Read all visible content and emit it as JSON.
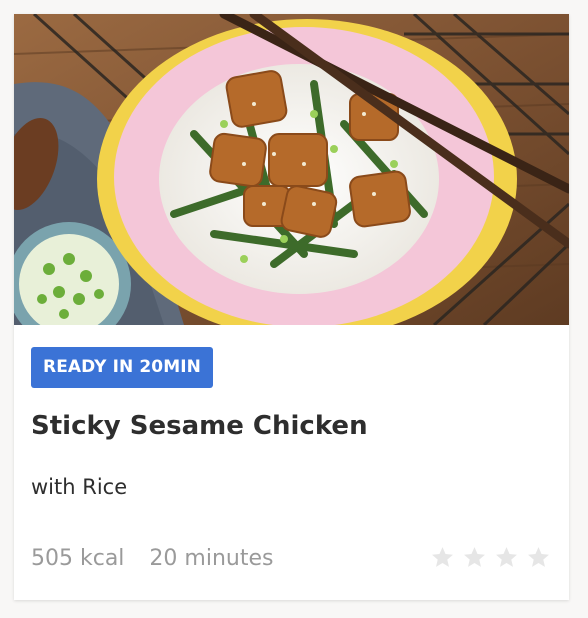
{
  "card": {
    "badge": "READY IN 20MIN",
    "title": "Sticky Sesame Chicken",
    "subtitle": "with Rice",
    "calories": "505 kcal",
    "duration": "20 minutes",
    "rating": {
      "filled": 0,
      "max": 4,
      "star_color": "#e6e6e6"
    }
  },
  "colors": {
    "badge_bg": "#3b73d6",
    "text": "#2e2e2e",
    "meta_text": "#9a9a9a"
  },
  "icons": {
    "photo": "recipe-photo-image",
    "star": "star-icon"
  }
}
